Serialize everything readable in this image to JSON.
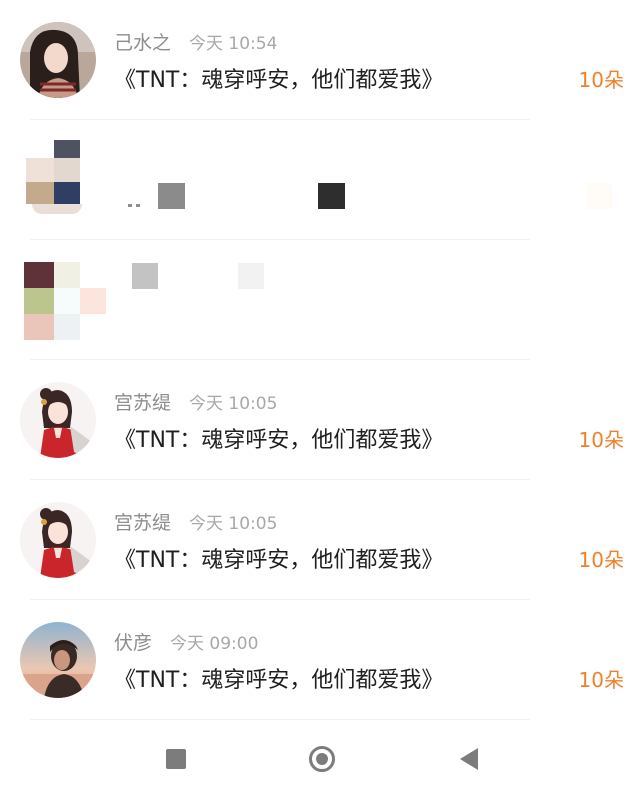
{
  "messages": [
    {
      "name": "己水之",
      "time": "今天 10:54",
      "text": "《TNT：魂穿呼安，他们都爱我》",
      "count": "10朵",
      "avatar": "girl-long-hair-avatar"
    },
    {
      "redacted": true,
      "avatar": "pixelated-avatar"
    },
    {
      "redacted": true,
      "avatar": "pixelated-avatar"
    },
    {
      "name": "宫苏缇",
      "time": "今天 10:05",
      "text": "《TNT：魂穿呼安，他们都爱我》",
      "count": "10朵",
      "avatar": "anime-girl-red-dress-avatar"
    },
    {
      "name": "宫苏缇",
      "time": "今天 10:05",
      "text": "《TNT：魂穿呼安，他们都爱我》",
      "count": "10朵",
      "avatar": "anime-girl-red-dress-avatar"
    },
    {
      "name": "伏彦",
      "time": "今天 09:00",
      "text": "《TNT：魂穿呼安，他们都爱我》",
      "count": "10朵",
      "avatar": "boy-sunset-avatar"
    }
  ],
  "navbar": {
    "items": [
      "recents-square-icon",
      "home-circle-icon",
      "back-triangle-icon"
    ]
  },
  "colors": {
    "accent": "#f0812a",
    "name": "#8d8d8d",
    "time": "#a8a8a8",
    "text": "#1f1f1f"
  }
}
